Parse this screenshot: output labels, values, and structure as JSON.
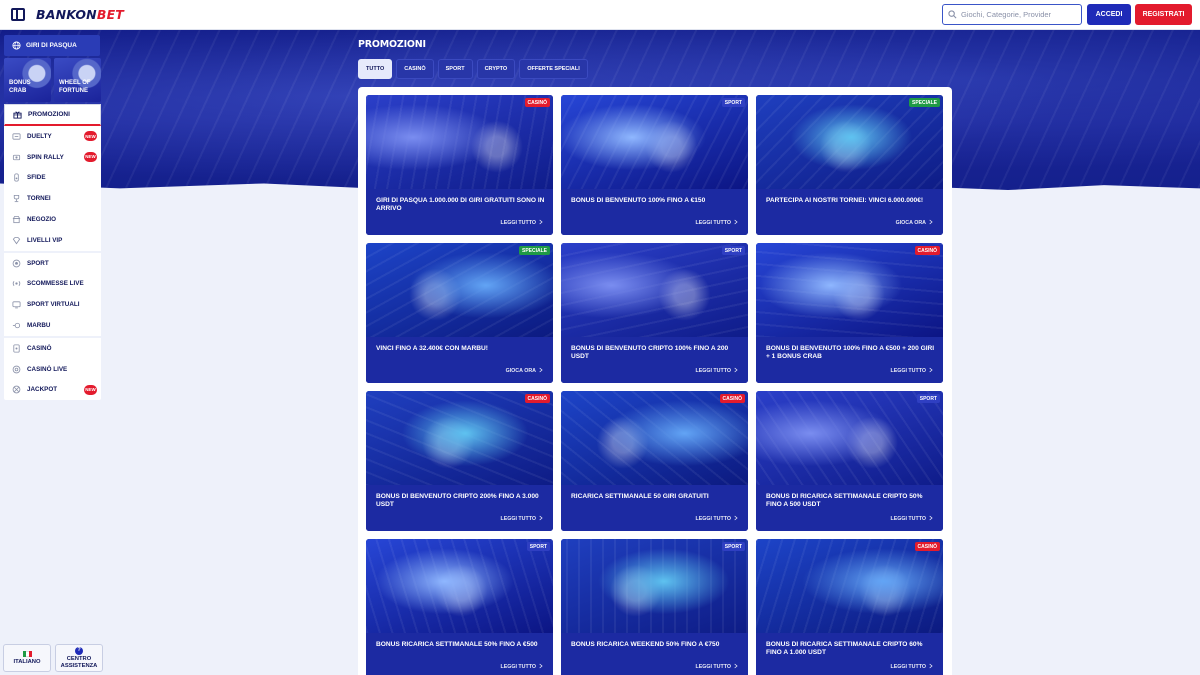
{
  "header": {
    "brand_main": "BANKON",
    "brand_accent": "BET",
    "search_placeholder": "Giochi, Categorie, Provider",
    "login_label": "ACCEDI",
    "register_label": "REGISTRATI"
  },
  "colors": {
    "navy": "#12185a",
    "brand_red": "#e31b2d",
    "primary_blue": "#1f2bb8",
    "badge_casino": "#e31b2d",
    "badge_sport": "#2f3fc2",
    "badge_special": "#1f9a45"
  },
  "sidebar": {
    "top_label": "GIRI DI PASQUA",
    "tiles": [
      {
        "l1": "BONUS",
        "l2": "CRAB"
      },
      {
        "l1": "WHEEL OF",
        "l2": "FORTUNE"
      }
    ],
    "promo_label": "PROMOZIONI",
    "group1": [
      {
        "label": "DUELTY",
        "icon": "duel-icon",
        "new": "NEW"
      },
      {
        "label": "SPIN RALLY",
        "icon": "rally-icon",
        "new": "NEW"
      },
      {
        "label": "SFIDE",
        "icon": "challenge-icon"
      },
      {
        "label": "TORNEI",
        "icon": "trophy-icon"
      },
      {
        "label": "NEGOZIO",
        "icon": "shop-icon"
      },
      {
        "label": "LIVELLI VIP",
        "icon": "diamond-icon"
      }
    ],
    "group2": [
      {
        "label": "SPORT",
        "icon": "ball-icon"
      },
      {
        "label": "SCOMMESSE LIVE",
        "icon": "live-icon"
      },
      {
        "label": "SPORT VIRTUALI",
        "icon": "virtual-icon"
      },
      {
        "label": "MARBU",
        "icon": "marbu-icon"
      }
    ],
    "group3": [
      {
        "label": "CASINÒ",
        "icon": "casino-icon"
      },
      {
        "label": "CASINÒ LIVE",
        "icon": "casino-live-icon"
      },
      {
        "label": "JACKPOT",
        "icon": "jackpot-icon",
        "new": "NEW"
      }
    ],
    "language_label": "ITALIANO",
    "help_l1": "CENTRO",
    "help_l2": "ASSISTENZA"
  },
  "main": {
    "page_title": "PROMOZIONI",
    "tabs": [
      "TUTTO",
      "CASINÒ",
      "SPORT",
      "CRYPTO",
      "OFFERTE SPECIALI"
    ],
    "active_tab": "TUTTO",
    "cards": [
      {
        "badge": "CASINÒ",
        "title": "GIRI DI PASQUA 1.000.000 DI GIRI GRATUITI SONO IN ARRIVO",
        "cta": "LEGGI TUTTO",
        "art": "woman-rabbit-art"
      },
      {
        "badge": "SPORT",
        "title": "BONUS DI BENVENUTO 100% FINO A €150",
        "cta": "LEGGI TUTTO",
        "art": "players-wolves-art"
      },
      {
        "badge": "SPECIALE",
        "title": "PARTECIPA AI NOSTRI TORNEI: VINCI 6.000.000€!",
        "cta": "GIOCA ORA",
        "art": "man-bull-art"
      },
      {
        "badge": "SPECIALE",
        "title": "VINCI FINO A 32.400€ CON MARBU!",
        "cta": "GIOCA ORA",
        "art": "marbles-art"
      },
      {
        "badge": "SPORT",
        "title": "BONUS DI BENVENUTO CRIPTO 100% FINO A 200 USDT",
        "cta": "LEGGI TUTTO",
        "art": "players-ball-art"
      },
      {
        "badge": "CASINÒ",
        "title": "BONUS DI BENVENUTO 100% FINO A €500 + 200 GIRI + 1 BONUS CRAB",
        "cta": "LEGGI TUTTO",
        "art": "cards-lion-art"
      },
      {
        "badge": "CASINÒ",
        "title": "BONUS DI BENVENUTO CRIPTO 200% FINO A 3.000 USDT",
        "cta": "LEGGI TUTTO",
        "art": "women-dice-art"
      },
      {
        "badge": "CASINÒ",
        "title": "RICARICA SETTIMANALE 50 GIRI GRATUITI",
        "cta": "LEGGI TUTTO",
        "art": "woman-swan-art"
      },
      {
        "badge": "SPORT",
        "title": "BONUS DI RICARICA SETTIMANALE CRIPTO 50% FINO A 500 USDT",
        "cta": "LEGGI TUTTO",
        "art": "man-bitcoin-art"
      },
      {
        "badge": "SPORT",
        "title": "BONUS RICARICA SETTIMANALE 50% FINO A €500",
        "cta": "LEGGI TUTTO",
        "art": "basketball-art"
      },
      {
        "badge": "SPORT",
        "title": "BONUS RICARICA WEEKEND 50% FINO A €750",
        "cta": "LEGGI TUTTO",
        "art": "soccer-wolf-art"
      },
      {
        "badge": "CASINÒ",
        "title": "BONUS DI RICARICA SETTIMANALE CRIPTO 60% FINO A 1.000 USDT",
        "cta": "LEGGI TUTTO",
        "art": "woman-eagle-art"
      }
    ]
  }
}
